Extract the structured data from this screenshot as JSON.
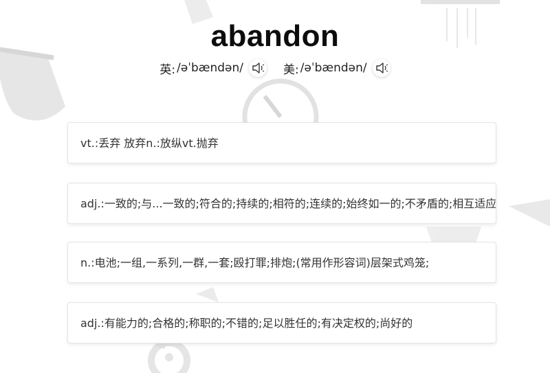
{
  "word": "abandon",
  "phonetics": [
    {
      "label": "英:",
      "symbol": "/əˈbændən/",
      "icon": "speaker-icon"
    },
    {
      "label": "美:",
      "symbol": "/əˈbændən/",
      "icon": "speaker-icon"
    }
  ],
  "definitions": [
    "vt.:丢弃 放弃n.:放纵vt.抛弃",
    "adj.:一致的;与...一致的;符合的;持续的;相符的;连续的;始终如一的;不矛盾的;相互适应的",
    "n.:电池;一组,一系列,一群,一套;殴打罪;排炮;(常用作形容词)层架式鸡笼;",
    "adj.:有能力的;合格的;称职的;不错的;足以胜任的;有决定权的;尚好的"
  ]
}
